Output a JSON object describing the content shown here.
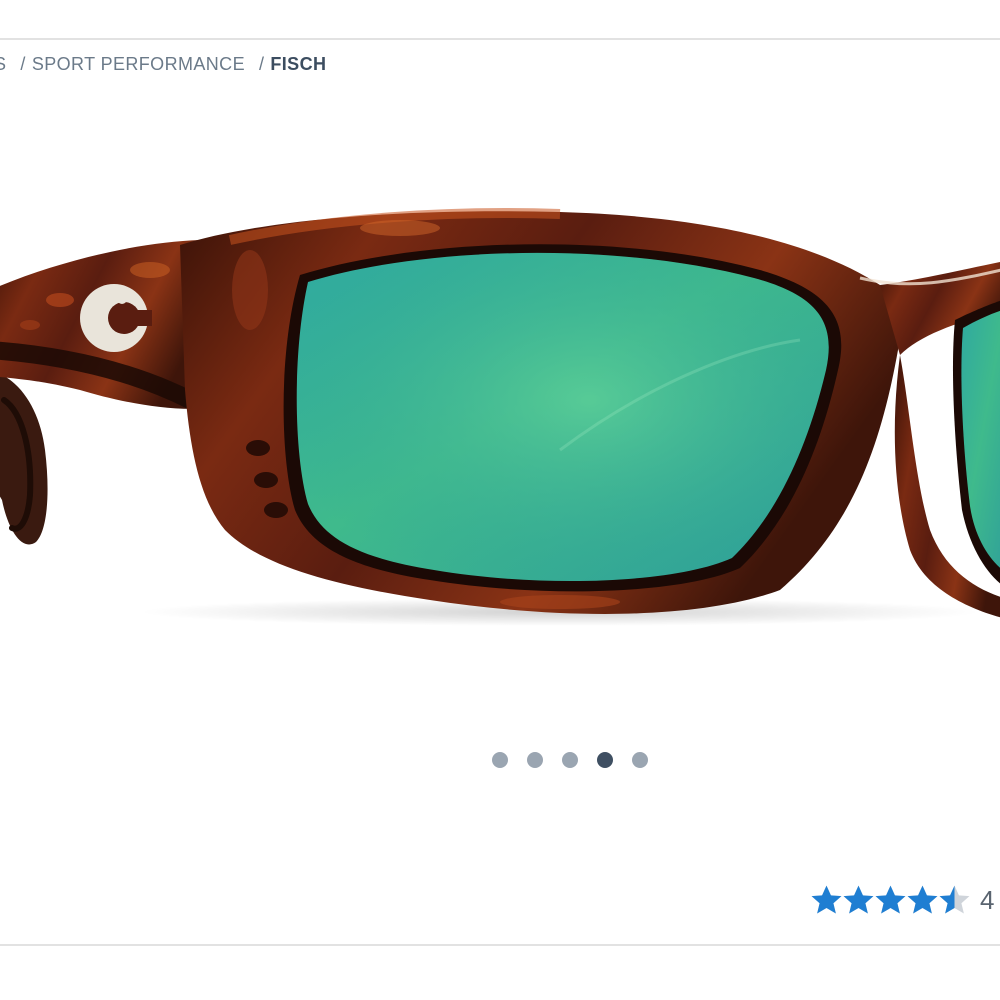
{
  "breadcrumb": {
    "items": [
      "S",
      "SPORT PERFORMANCE"
    ],
    "separator": "/",
    "current": "FISCH"
  },
  "product": {
    "image_label": "tortoise frame sunglasses with green mirror lenses",
    "logo_icon": "costa-c-logo-icon",
    "colors": {
      "frame": "#5a1d10",
      "lens": "#3fb98f"
    }
  },
  "carousel": {
    "total": 5,
    "active_index": 3
  },
  "rating": {
    "stars": 4.5,
    "max_stars": 5,
    "value": "4",
    "star_color": "#1f7ed2",
    "empty_star_color": "#cfd4da"
  }
}
